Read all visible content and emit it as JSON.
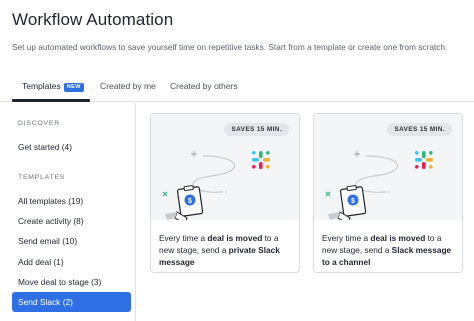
{
  "header": {
    "title": "Workflow Automation",
    "subtitle": "Set up automated workflows to save yourself time on repetitive tasks. Start from a template or create one from scratch."
  },
  "tabs": [
    {
      "label": "Templates",
      "badge": "NEW",
      "active": true
    },
    {
      "label": "Created by me",
      "active": false
    },
    {
      "label": "Created by others",
      "active": false
    }
  ],
  "sidebar": {
    "discover_heading": "DISCOVER",
    "discover_items": [
      {
        "label": "Get started (4)"
      }
    ],
    "templates_heading": "TEMPLATES",
    "template_items": [
      {
        "label": "All templates (19)",
        "selected": false
      },
      {
        "label": "Create activity (8)",
        "selected": false
      },
      {
        "label": "Send email (10)",
        "selected": false
      },
      {
        "label": "Add deal (1)",
        "selected": false
      },
      {
        "label": "Move deal to stage (3)",
        "selected": false
      },
      {
        "label": "Send Slack (2)",
        "selected": true
      }
    ]
  },
  "cards": [
    {
      "saves": "SAVES 15 MIN.",
      "text_1": "Every time a ",
      "text_bold_1": "deal is moved",
      "text_2": " to a new stage, send a ",
      "text_bold_2": "private Slack message",
      "text_3": ""
    },
    {
      "saves": "SAVES 15 MIN.",
      "text_1": "Every time a ",
      "text_bold_1": "deal is moved",
      "text_2": " to a new stage, send a ",
      "text_bold_2": "Slack message to a channel",
      "text_3": ""
    }
  ],
  "colors": {
    "accent": "#2f6fe4",
    "slack_green": "#2eb67d",
    "slack_red": "#e01e5a",
    "slack_yellow": "#ecb22e",
    "slack_blue": "#36c5f0"
  }
}
